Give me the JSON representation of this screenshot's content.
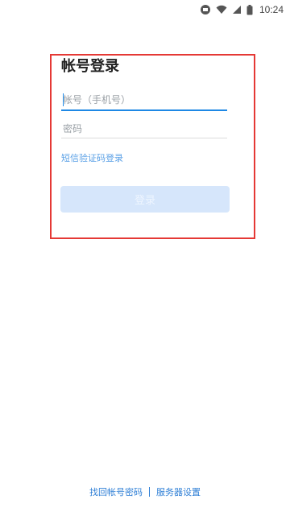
{
  "status_bar": {
    "time": "10:24",
    "icons": [
      "android-debug-icon",
      "wifi-icon",
      "signal-icon",
      "battery-icon"
    ]
  },
  "login_form": {
    "title": "帐号登录",
    "account_placeholder": "帐号（手机号）",
    "password_placeholder": "密码",
    "sms_login_label": "短信验证码登录",
    "login_button_label": "登录"
  },
  "footer": {
    "recover_account_label": "找回帐号密码",
    "server_settings_label": "服务器设置"
  },
  "colors": {
    "accent": "#1e88e5",
    "link": "#2f7fd6",
    "highlight": "#e53935",
    "button_disabled_bg": "#d6e6fb"
  }
}
